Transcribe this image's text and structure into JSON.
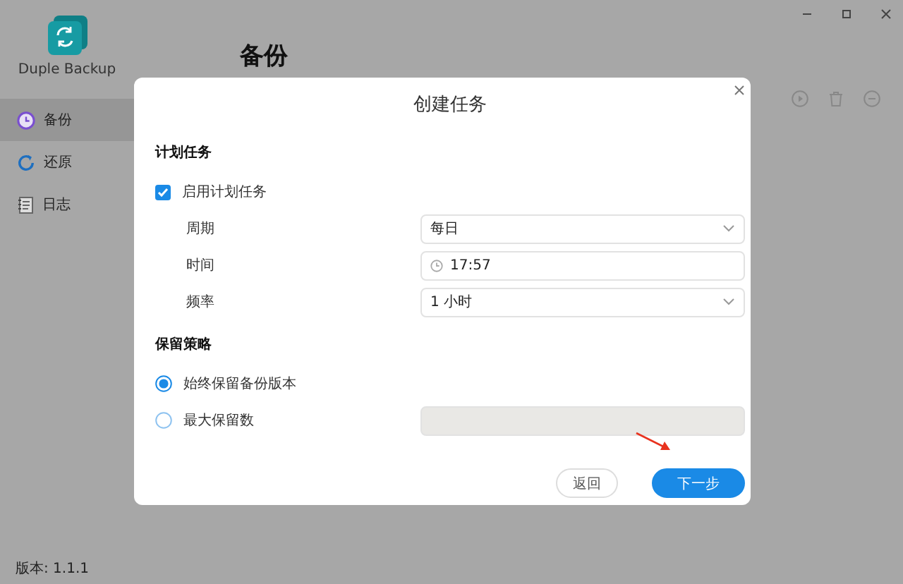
{
  "app": {
    "name": "Duple Backup"
  },
  "sidebar": {
    "items": [
      {
        "label": "备份",
        "kind": "backup",
        "selected": true
      },
      {
        "label": "还原",
        "kind": "restore",
        "selected": false
      },
      {
        "label": "日志",
        "kind": "log",
        "selected": false
      }
    ]
  },
  "page": {
    "title": "备份"
  },
  "version": "版本: 1.1.1",
  "dialog": {
    "title": "创建任务",
    "sections": [
      {
        "title": "计划任务",
        "items": [
          {
            "kind": "checkbox",
            "label": "启用计划任务",
            "checked": true
          },
          {
            "kind": "select",
            "label": "周期",
            "value": "每日"
          },
          {
            "kind": "time",
            "label": "时间",
            "value": "17:57"
          },
          {
            "kind": "select",
            "label": "频率",
            "value": "1 小时"
          }
        ]
      },
      {
        "title": "保留策略",
        "items": [
          {
            "kind": "radio",
            "label": "始终保留备份版本",
            "selected": true
          },
          {
            "kind": "radio",
            "label": "最大保留数",
            "selected": false,
            "field": {
              "disabled": true
            }
          }
        ]
      }
    ],
    "buttons": [
      {
        "label": "返回",
        "kind": "secondary"
      },
      {
        "label": "下一步",
        "kind": "primary"
      }
    ]
  }
}
